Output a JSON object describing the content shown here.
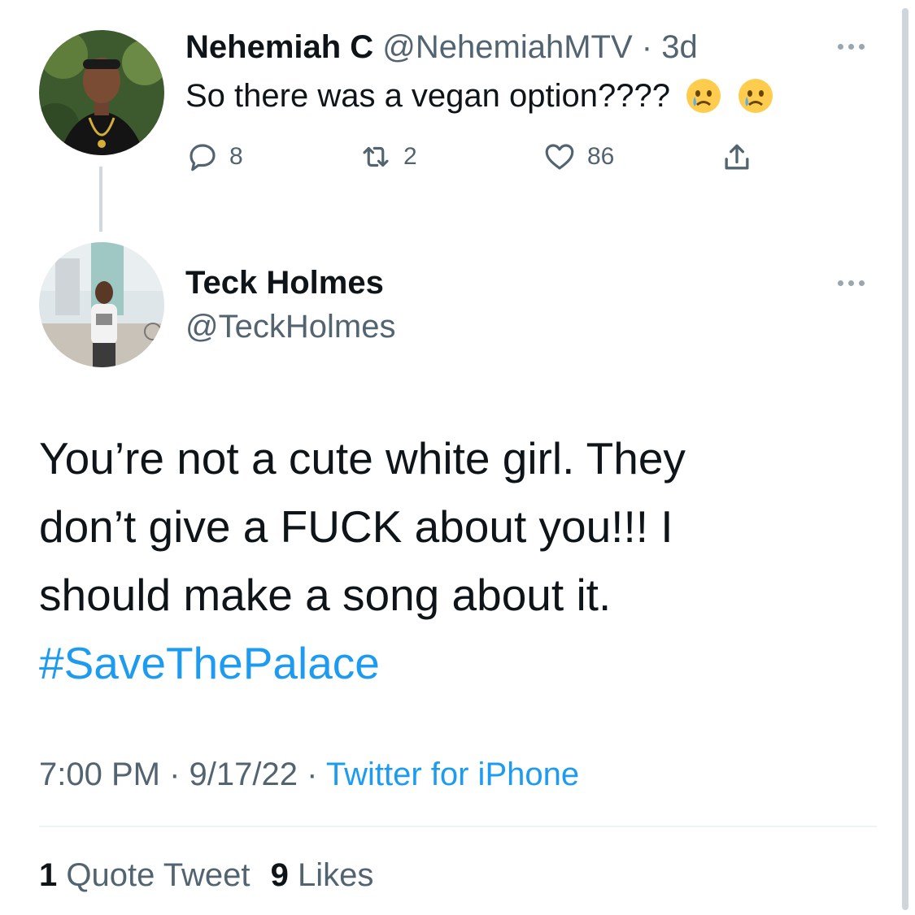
{
  "parent_tweet": {
    "author_name": "Nehemiah C",
    "handle": "@NehemiahMTV",
    "separator": "·",
    "age": "3d",
    "text": "So there was a vegan option????",
    "emojis": [
      "crying-face-icon",
      "crying-face-icon"
    ],
    "replies": "8",
    "retweets": "2",
    "likes": "86"
  },
  "main_tweet": {
    "author_name": "Teck Holmes",
    "handle": "@TeckHolmes",
    "text_lines": [
      "You’re not a cute white girl. They",
      "don’t give a FUCK about you!!! I",
      "should make a song about it."
    ],
    "hashtag": "#SaveThePalace",
    "time": "7:00 PM",
    "sep1": "·",
    "date": "9/17/22",
    "sep2": "·",
    "source": "Twitter for iPhone"
  },
  "stats": {
    "quote_count": "1",
    "quote_label": "Quote Tweet",
    "like_count": "9",
    "like_label": "Likes"
  },
  "colors": {
    "accent": "#1d9bf0",
    "text": "#0f1419",
    "muted": "#536471"
  }
}
